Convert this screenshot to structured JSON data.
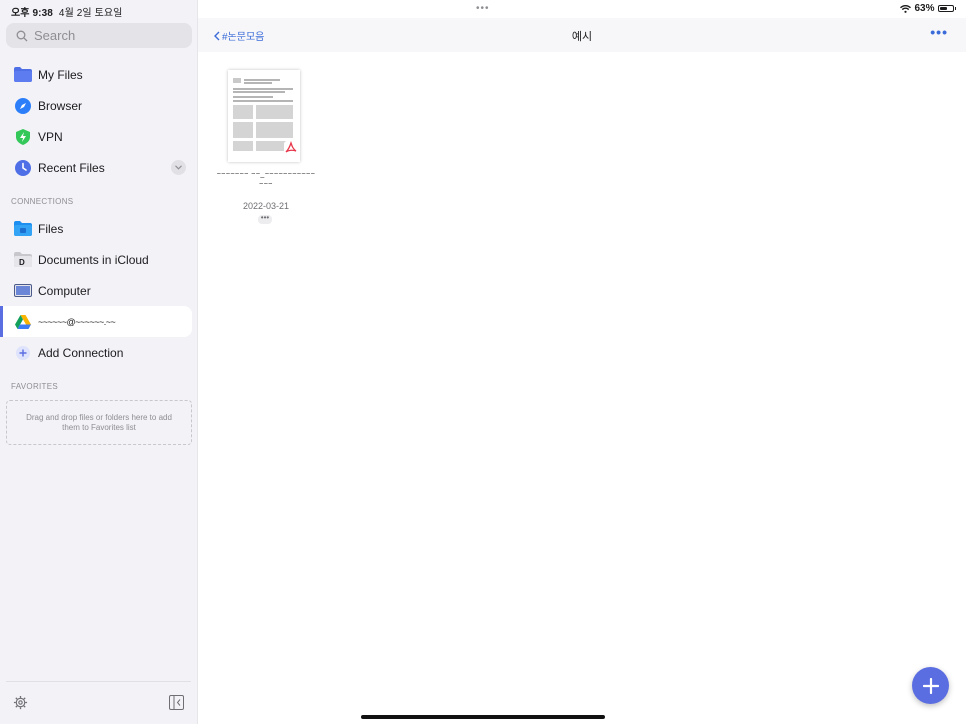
{
  "status": {
    "time": "오후 9:38",
    "date": "4월 2일 토요일",
    "battery": "63%",
    "battery_level": 0.63
  },
  "sidebar": {
    "search_placeholder": "Search",
    "items": [
      {
        "label": "My Files",
        "icon": "folder-icon",
        "color": "#4f6fe6"
      },
      {
        "label": "Browser",
        "icon": "compass-icon",
        "color": "#2d7ff9"
      },
      {
        "label": "VPN",
        "icon": "vpn-shield-icon",
        "color": "#34c759"
      },
      {
        "label": "Recent Files",
        "icon": "clock-icon",
        "color": "#4f6fe6"
      }
    ],
    "connections_title": "CONNECTIONS",
    "connections": [
      {
        "label": "Files",
        "icon": "files-folder-icon"
      },
      {
        "label": "Documents in iCloud",
        "icon": "documents-app-icon"
      },
      {
        "label": "Computer",
        "icon": "laptop-icon"
      },
      {
        "label": "~~~~~~@~~~~~~.~~",
        "icon": "google-drive-icon",
        "active": true
      },
      {
        "label": "Add Connection",
        "icon": "plus-circle-icon"
      }
    ],
    "favorites_title": "FAVORITES",
    "favorites_hint": "Drag and drop files or folders here to add them to Favorites list"
  },
  "nav": {
    "back_label": "#논문모음",
    "title": "예시"
  },
  "files": [
    {
      "name": "~~~~~~~ ~~_~~~~~~~~~~~~~~",
      "date": "2022-03-21",
      "type": "pdf"
    }
  ],
  "colors": {
    "accent": "#5b6ee1",
    "link": "#3a6bd9",
    "pdf": "#e8364a"
  }
}
